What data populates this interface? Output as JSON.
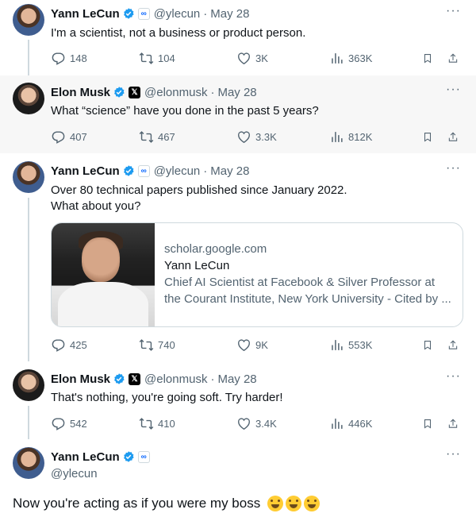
{
  "colors": {
    "text": "#0f1419",
    "muted": "#536471",
    "verified": "#1d9bf0",
    "highlight_bg": "#f7f7f7",
    "meta_blue": "#0866ff"
  },
  "tweets": [
    {
      "name": "Yann LeCun",
      "handle": "@ylecun",
      "dot": "·",
      "date": "May 28",
      "affiliation": "meta-icon",
      "text": "I'm a scientist, not a business or product person.",
      "replies": "148",
      "retweets": "104",
      "likes": "3K",
      "views": "363K"
    },
    {
      "name": "Elon Musk",
      "handle": "@elonmusk",
      "dot": "·",
      "date": "May 28",
      "affiliation": "x-icon",
      "text": "What “science” have you done in the past 5 years?",
      "replies": "407",
      "retweets": "467",
      "likes": "3.3K",
      "views": "812K"
    },
    {
      "name": "Yann LeCun",
      "handle": "@ylecun",
      "dot": "·",
      "date": "May 28",
      "affiliation": "meta-icon",
      "text": "Over 80 technical papers published since January 2022.\nWhat about you?",
      "card": {
        "domain": "scholar.google.com",
        "title": "Yann LeCun",
        "description": "Chief AI Scientist at Facebook & Silver Professor at the Courant Institute, New York University - Cited by ..."
      },
      "replies": "425",
      "retweets": "740",
      "likes": "9K",
      "views": "553K"
    },
    {
      "name": "Elon Musk",
      "handle": "@elonmusk",
      "dot": "·",
      "date": "May 28",
      "affiliation": "x-icon",
      "text": "That's nothing, you're going soft. Try harder!",
      "replies": "542",
      "retweets": "410",
      "likes": "3.4K",
      "views": "446K"
    },
    {
      "name": "Yann LeCun",
      "handle": "@ylecun",
      "affiliation": "meta-icon",
      "text": "Now you're acting as if you were my boss",
      "emojis": [
        "face-with-tears-of-joy",
        "face-with-tears-of-joy",
        "face-with-tears-of-joy"
      ]
    }
  ],
  "icons": {
    "more": "more-icon",
    "reply": "reply-icon",
    "retweet": "retweet-icon",
    "like": "like-icon",
    "views": "views-icon",
    "bookmark": "bookmark-icon",
    "share": "share-icon",
    "verified": "verified-badge-icon"
  }
}
